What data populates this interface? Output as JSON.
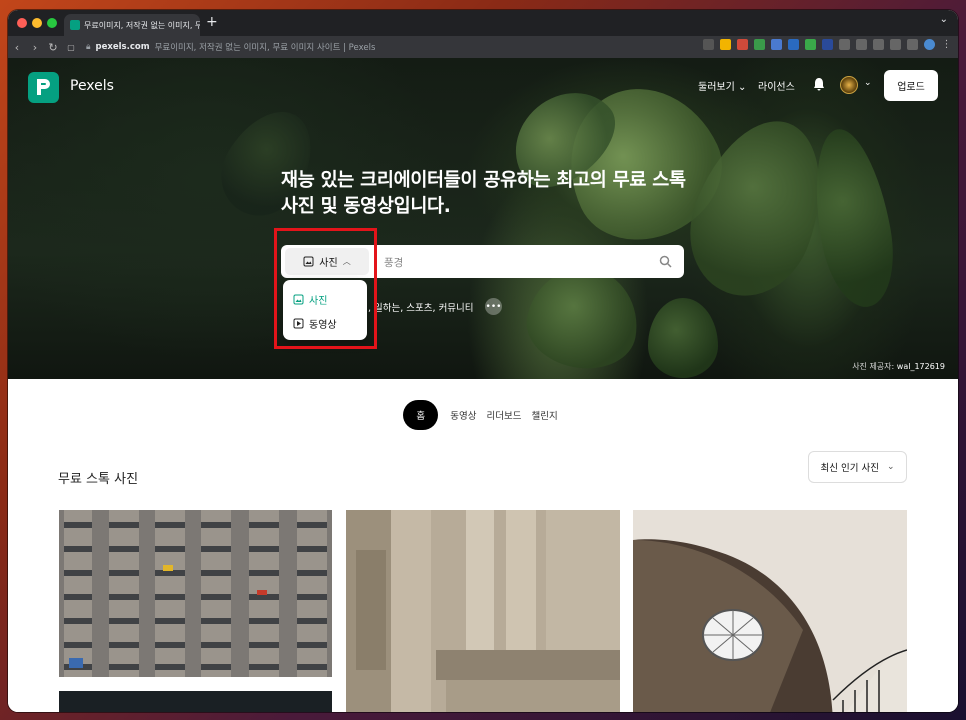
{
  "browser": {
    "tab_title": "무료이미지, 저작권 없는 이미지, 무료",
    "tab_close": "×",
    "new_tab": "+",
    "url_domain": "pexels.com",
    "url_title": "무료이미지, 저작권 없는 이미지, 무료 이미지 사이트 | Pexels"
  },
  "header": {
    "brand": "Pexels",
    "explore": "둘러보기",
    "license": "라이선스",
    "upload": "업로드"
  },
  "hero": {
    "headline": "재능 있는 크리에이터들이 공유하는 최고의 무료 스톡 사진 및 동영상입니다.",
    "search_type": "사진",
    "search_placeholder": "풍경",
    "tags": "일하는, 스포츠, 커뮤니티",
    "credit_label": "사진 제공자:",
    "credit_name": "wal_172619"
  },
  "dropdown": {
    "items": [
      {
        "label": "사진",
        "icon": "image-icon",
        "selected": true
      },
      {
        "label": "동영상",
        "icon": "video-icon",
        "selected": false
      }
    ]
  },
  "content_tabs": [
    "홈",
    "동영상",
    "리더보드",
    "챌린지"
  ],
  "section": {
    "title": "무료 스톡 사진",
    "sort": "최신 인기 사진"
  },
  "colors": {
    "brand": "#05a081",
    "highlight": "#e3141a"
  }
}
